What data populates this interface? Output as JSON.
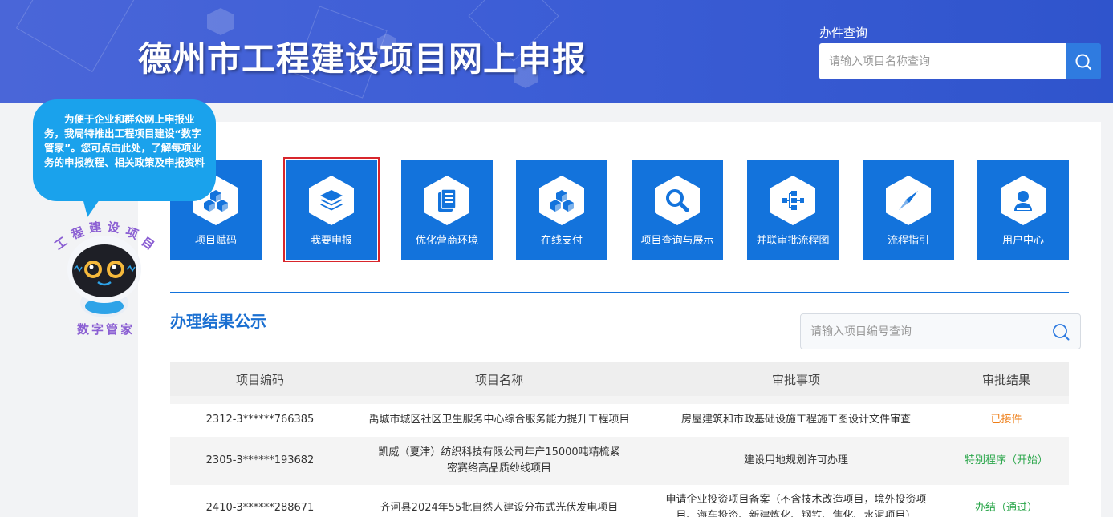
{
  "header": {
    "title": "德州市工程建设项目网上申报",
    "search_label": "办件查询",
    "search_placeholder": "请输入项目名称查询"
  },
  "colors": {
    "header": "#3d5ed6",
    "tile": "#1373dc",
    "selected_outline": "#d8262c",
    "bubble": "#1aa2ec"
  },
  "tiles": [
    {
      "label": "项目赋码",
      "icon": "cubes-icon"
    },
    {
      "label": "我要申报",
      "icon": "layers-icon",
      "selected": true
    },
    {
      "label": "优化营商环境",
      "icon": "clipboard-icon"
    },
    {
      "label": "在线支付",
      "icon": "cubes-icon"
    },
    {
      "label": "项目查询与展示",
      "icon": "search-icon"
    },
    {
      "label": "并联审批流程图",
      "icon": "flowchart-icon"
    },
    {
      "label": "流程指引",
      "icon": "compass-icon"
    },
    {
      "label": "用户中心",
      "icon": "user-icon"
    }
  ],
  "results": {
    "title": "办理结果公示",
    "search_placeholder": "请输入项目编号查询",
    "columns": [
      "项目编码",
      "项目名称",
      "审批事项",
      "审批结果"
    ],
    "rows": [
      {
        "code": "2312-3******766385",
        "name": "禹城市城区社区卫生服务中心综合服务能力提升工程项目",
        "item": "房屋建筑和市政基础设施工程施工图设计文件审查",
        "result": "已接件",
        "status": "orange"
      },
      {
        "code": "2305-3******193682",
        "name": "凯威（夏津）纺织科技有限公司年产15000吨精梳紧密赛络高品质纱线项目",
        "item": "建设用地规划许可办理",
        "result": "特别程序（开始）",
        "status": "green"
      },
      {
        "code": "2410-3******288671",
        "name": "齐河县2024年55批自然人建设分布式光伏发电项目",
        "item": "申请企业投资项目备案（不含技术改造项目，境外投资项目、海车投资、新建炼化、钢铁、焦化、水泥项目）",
        "result": "办结（通过）",
        "status": "green"
      }
    ]
  },
  "mascot": {
    "bubble_text": "为便于企业和群众网上申报业务，我局特推出工程项目建设“数字管家”。您可点击此处，了解每项业务的申报教程、相关政策及申报资料",
    "arc_text": [
      "工",
      "程",
      "建",
      "设",
      "项",
      "目"
    ],
    "caption": "数字管家"
  }
}
